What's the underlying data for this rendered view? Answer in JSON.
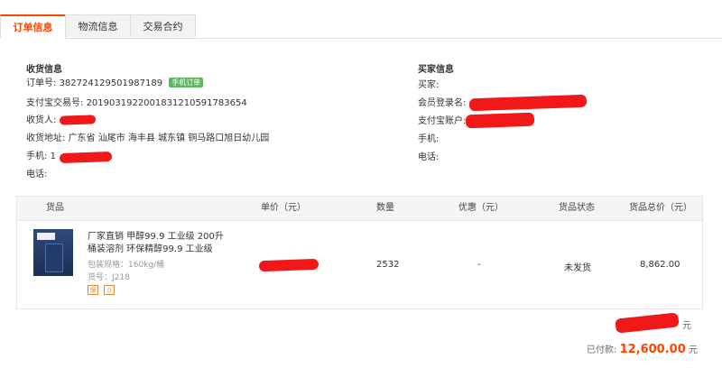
{
  "tabs": [
    {
      "label": "订单信息",
      "active": true
    },
    {
      "label": "物流信息",
      "active": false
    },
    {
      "label": "交易合约",
      "active": false
    }
  ],
  "shipping": {
    "title": "收货信息",
    "order_label": "订单号:",
    "order_no": "382724129501987189",
    "mobile_badge": "手机订单",
    "alipay_label": "支付宝交易号:",
    "alipay_no": "2019031922001831210591783654",
    "receiver_label": "收货人:",
    "address_label": "收货地址:",
    "address": "广东省 汕尾市 海丰县 城东镇 铜马路口旭日幼儿园",
    "phone_label": "手机:",
    "phone_prefix": "1",
    "tel_label": "电话:"
  },
  "buyer": {
    "title": "买家信息",
    "buyer_label": "买家:",
    "member_label": "会员登录名:",
    "alipay_account_label": "支付宝账户:",
    "phone_label": "手机:",
    "tel_label": "电话:"
  },
  "table": {
    "headers": [
      "货品",
      "单价（元）",
      "数量",
      "优惠（元）",
      "货品状态",
      "货品总价（元）"
    ],
    "row": {
      "name_line1": "厂家直销 甲醇99.9 工业级 200升",
      "name_line2": "桶装溶剂 环保精醇99.9 工业级",
      "spec": "包装规格：160kg/桶",
      "sku": "货号：J218",
      "quantity": "2532",
      "discount": "-",
      "status": "未发货",
      "total": "8,862.00"
    },
    "icons": [
      "保",
      "⊙"
    ]
  },
  "summary": {
    "yuan_suffix": "元",
    "paid_label": "已付款:",
    "paid_amount": "12,600.00",
    "paid_unit": "元"
  },
  "colors": {
    "accent": "#ff4400",
    "badge": "#5cb85c",
    "redaction": "#f01818"
  }
}
